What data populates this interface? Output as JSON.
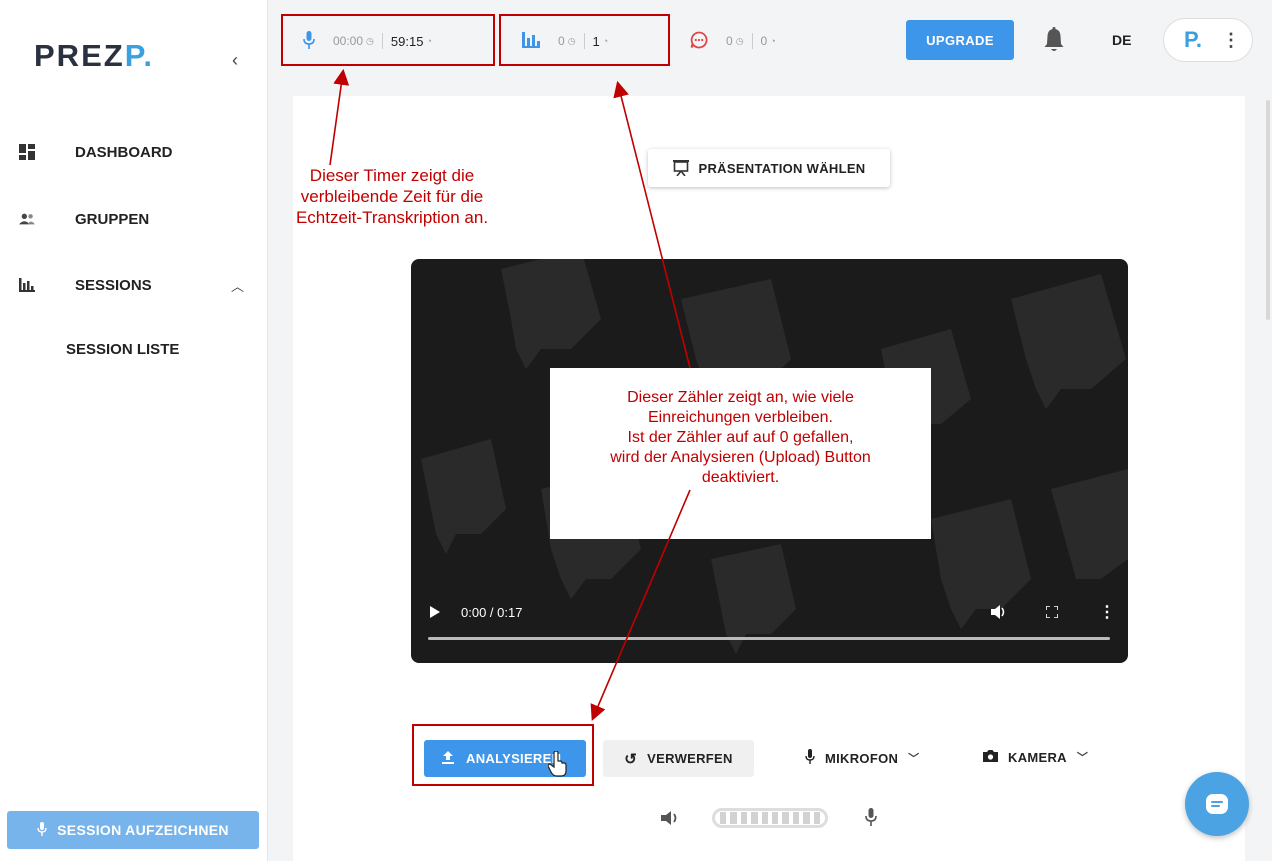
{
  "sidebar": {
    "logo_main": "PREZ",
    "logo_accent": "P.",
    "collapse_glyph": "‹",
    "items": [
      {
        "label": "DASHBOARD",
        "icon": "dashboard-icon"
      },
      {
        "label": "GRUPPEN",
        "icon": "groups-icon"
      },
      {
        "label": "SESSIONS",
        "icon": "bar-chart-icon",
        "expanded": true
      }
    ],
    "sub_items": [
      {
        "label": "SESSION LISTE"
      }
    ],
    "record_button": "SESSION AUFZEICHNEN"
  },
  "topbar": {
    "transcription": {
      "used": "00:00",
      "remaining": "59:15"
    },
    "submissions": {
      "used": "0",
      "remaining": "1"
    },
    "comments": {
      "used": "0",
      "remaining": "0"
    },
    "upgrade_label": "UPGRADE",
    "language": "DE",
    "profile_initial": "P."
  },
  "main": {
    "choose_presentation": "PRÄSENTATION WÄHLEN",
    "video": {
      "time": "0:00 / 0:17",
      "progress": 0.0
    },
    "analyze_label": "ANALYSIEREN",
    "discard_label": "VERWERFEN",
    "microphone_label": "MIKROFON",
    "camera_label": "KAMERA"
  },
  "annotations": {
    "timer_note": "Dieser Timer zeigt die verbleibende Zeit für die Echtzeit-Transkription an.",
    "counter_note_1": "Dieser Zähler zeigt an, wie viele",
    "counter_note_2": "Einreichungen verbleiben.",
    "counter_note_3": "Ist der Zähler auf auf 0 gefallen,",
    "counter_note_4": "wird der Analysieren (Upload) Button",
    "counter_note_5": "deaktiviert."
  },
  "colors": {
    "accent": "#3d96ea",
    "annotation_red": "#c00000",
    "comment_red": "#e0454a"
  }
}
